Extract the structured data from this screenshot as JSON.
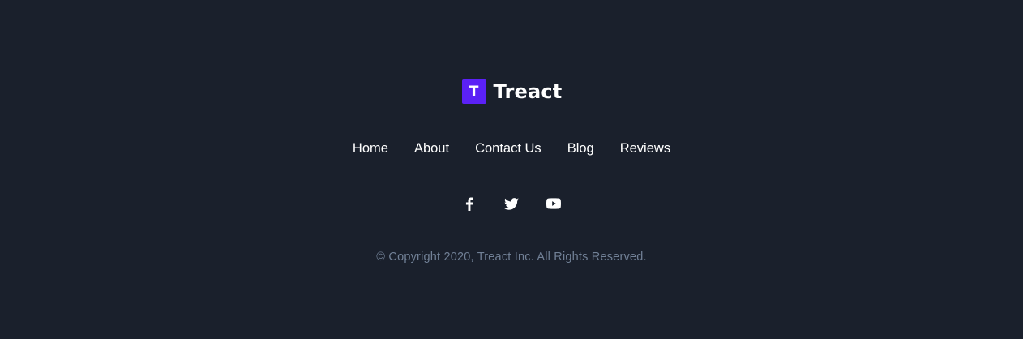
{
  "brand": {
    "logo_letter": "T",
    "name": "Treact",
    "accent_color": "#5b21f6"
  },
  "nav": {
    "items": [
      {
        "label": "Home"
      },
      {
        "label": "About"
      },
      {
        "label": "Contact Us"
      },
      {
        "label": "Blog"
      },
      {
        "label": "Reviews"
      }
    ]
  },
  "social": {
    "items": [
      {
        "icon": "facebook-icon"
      },
      {
        "icon": "twitter-icon"
      },
      {
        "icon": "youtube-icon"
      }
    ]
  },
  "footer": {
    "copyright": "© Copyright 2020, Treact Inc. All Rights Reserved."
  },
  "colors": {
    "background": "#1a202c",
    "text": "#ffffff",
    "muted_text": "#718096"
  }
}
